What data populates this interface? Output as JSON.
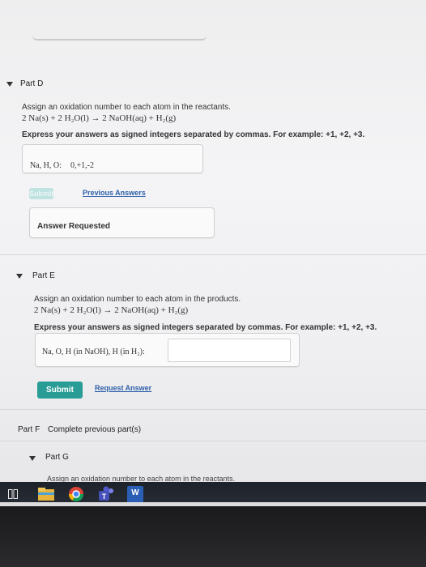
{
  "part_d": {
    "title": "Part D",
    "instruction": "Assign an oxidation number to each atom in the reactants.",
    "equation": "2 Na(s) + 2 H₂O(l) → 2 NaOH(aq) + H₂(g)",
    "format_note": "Express your answers as signed integers separated by commas. For example: +1, +2, +3.",
    "input_label": "Na, H, O:",
    "input_value": "0,+1,-2",
    "submit_label": "Submit",
    "previous_answers_link": "Previous Answers",
    "feedback": "Answer Requested"
  },
  "part_e": {
    "title": "Part E",
    "instruction": "Assign an oxidation number to each atom in the products.",
    "equation": "2 Na(s) + 2 H₂O(l) → 2 NaOH(aq) + H₂(g)",
    "format_note": "Express your answers as signed integers separated by commas. For example: +1, +2, +3.",
    "input_label": "Na, O, H (in NaOH), H (in H₂):",
    "input_value": "",
    "submit_label": "Submit",
    "request_answer_link": "Request Answer"
  },
  "part_f": {
    "title": "Part F",
    "status": "Complete previous part(s)"
  },
  "part_g": {
    "title": "Part G",
    "instruction": "Assign an oxidation number to each atom in the reactants."
  },
  "taskbar": {
    "icons": [
      "task-view-icon",
      "file-explorer-icon",
      "chrome-icon",
      "teams-icon",
      "word-icon"
    ],
    "word_letter": "W",
    "teams_letter": "T"
  },
  "colors": {
    "submit_active": "#2a9c96",
    "submit_disabled": "#bfe3e0",
    "link": "#2d5fa8",
    "taskbar": "#1f242d"
  }
}
